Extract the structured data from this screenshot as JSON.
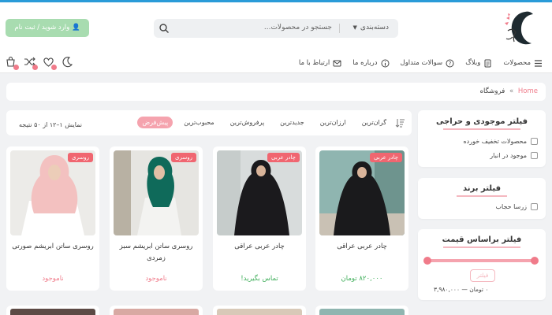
{
  "colors": {
    "accent": "#f07b8a",
    "top_line": "#2a9bd8",
    "login_bg": "#a8dcb0",
    "in_stock": "#3fae5a",
    "out_of_stock": "#f07b8a"
  },
  "header": {
    "login_label": "وارد شوید / ثبت نام",
    "search": {
      "placeholder": "جستجو در محصولات...",
      "category": "دسته‌بندی"
    },
    "menu": [
      {
        "label": "محصولات",
        "icon": "hamburger-icon"
      },
      {
        "label": "وبلاگ",
        "icon": "document-icon"
      },
      {
        "label": "سوالات متداول",
        "icon": "question-icon"
      },
      {
        "label": "درباره ما",
        "icon": "info-icon"
      },
      {
        "label": "ارتباط با ما",
        "icon": "mail-icon"
      }
    ],
    "icons": [
      "cart-icon",
      "shuffle-icon",
      "heart-icon",
      "moon-icon"
    ]
  },
  "breadcrumb": {
    "home": "Home",
    "separator": "»",
    "current": "فروشگاه"
  },
  "filters": {
    "stock": {
      "title": "فیلتر موجودی و حراجی",
      "options": [
        "محصولات تخفیف خورده",
        "موجود در انبار"
      ]
    },
    "brand": {
      "title": "فیلتر برند",
      "options": [
        "زرسا حجاب"
      ]
    },
    "price": {
      "title": "فیلتر براساس قیمت",
      "button": "فیلتر",
      "range_text": "قیمت: ۰ تومان — ۳,۹۸۰,۰۰۰ تومان",
      "range_short": "۰ تومان — ۳,۹۸۰,۰۰۰",
      "min": 0,
      "max": 1
    }
  },
  "sort": {
    "options": [
      "پیش‌فرض",
      "محبوب‌ترین",
      "پرفروش‌ترین",
      "جدیدترین",
      "ارزان‌ترین",
      "گران‌ترین"
    ],
    "active": 0,
    "result_count": "نمایش ۱–۱۲ از ۵۰ نتیجه"
  },
  "products": [
    {
      "tag": "چادر عربی",
      "name": "چادر عربی عراقی",
      "price": "۸۲۰,۰۰۰ تومان",
      "status": "price"
    },
    {
      "tag": "چادر عربی",
      "name": "چادر عربی عراقی",
      "price": "تماس بگیرید!",
      "status": "call"
    },
    {
      "tag": "روسری",
      "name": "روسری ساتن ابریشم سبز زمردی",
      "price": "ناموجود",
      "status": "out"
    },
    {
      "tag": "روسری",
      "name": "روسری ساتن ابریشم صورتی",
      "price": "ناموجود",
      "status": "out"
    }
  ]
}
